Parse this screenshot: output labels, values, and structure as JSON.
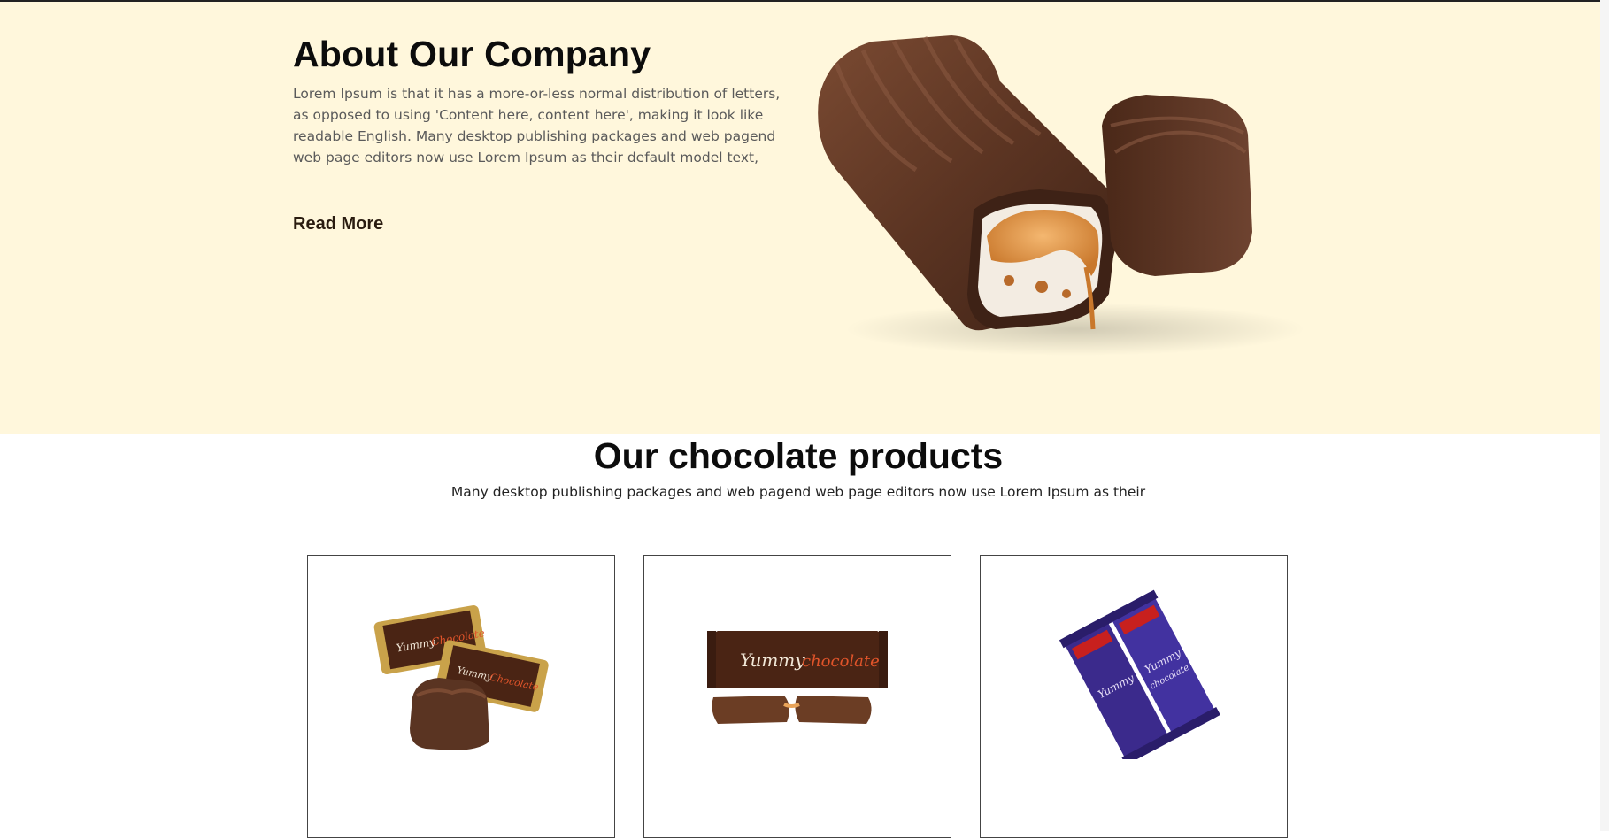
{
  "about": {
    "title": "About Our Company",
    "text": "Lorem Ipsum is that it has a more-or-less normal distribution of letters, as opposed to using 'Content here, content here', making it look like readable English. Many desktop publishing packages and web pagend web page editors now use Lorem Ipsum as their default model text,",
    "read_more": "Read More",
    "image_icon": "chocolate-bar-image"
  },
  "products": {
    "title": "Our chocolate products",
    "subtitle": "Many desktop publishing packages and web pagend web page editors now use Lorem Ipsum as their",
    "items": [
      {
        "image_icon": "wrapped-chocolate-candies-image",
        "wrapper_text_1": "Yummy",
        "wrapper_text_2": "Chocolate"
      },
      {
        "image_icon": "chocolate-bar-wrapper-image",
        "wrapper_text_1": "Yummy",
        "wrapper_text_2": "chocolate"
      },
      {
        "image_icon": "purple-chocolate-bars-image",
        "wrapper_text_1": "Yummy",
        "wrapper_text_2": "chocolate"
      }
    ]
  },
  "colors": {
    "about_bg": "#fff7dc",
    "chocolate": "#5a3422",
    "caramel": "#d98a3a",
    "purple_wrapper": "#3b2a8c"
  }
}
